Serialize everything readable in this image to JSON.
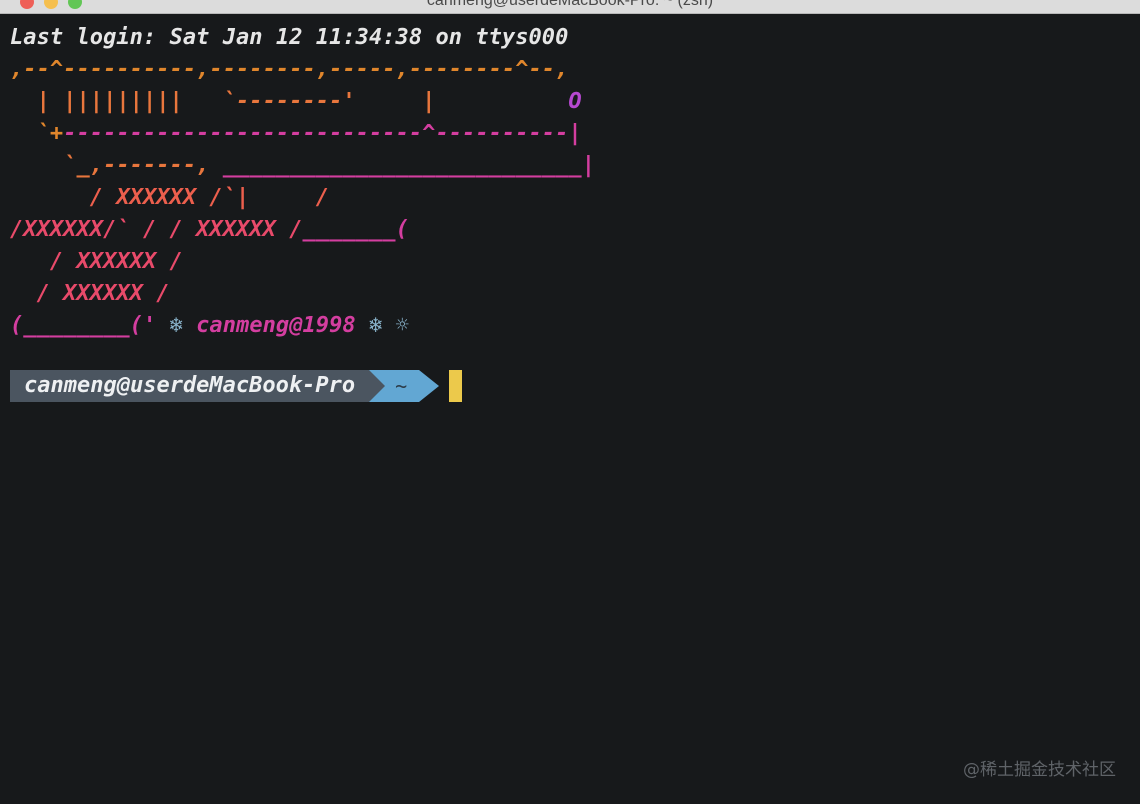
{
  "window": {
    "title": "canmeng@userdeMacBook-Pro: ~ (zsh)"
  },
  "terminal": {
    "login_line": "Last login: Sat Jan 12 11:34:38 on ttys000",
    "art": [
      {
        "segments": [
          {
            "text": ",--^----------,--------,-----,--------^--,",
            "color": "orange"
          }
        ]
      },
      {
        "segments": [
          {
            "text": "  | |||||||||   `--------'     |",
            "color": "orange2"
          },
          {
            "text": "          O",
            "color": "purple"
          }
        ]
      },
      {
        "segments": [
          {
            "text": "  `+",
            "color": "orange"
          },
          {
            "text": "---------------------------^----------|",
            "color": "magenta"
          }
        ]
      },
      {
        "segments": [
          {
            "text": "    `_,-------, ",
            "color": "orange2"
          },
          {
            "text": "___________________________|",
            "color": "magenta"
          }
        ]
      },
      {
        "segments": [
          {
            "text": "      / XXXXXX /`|     /",
            "color": "coral"
          }
        ]
      },
      {
        "segments": [
          {
            "text": "/XXXXXX/` / / XXXXXX /",
            "color": "pink"
          },
          {
            "text": "_______(",
            "color": "magenta"
          }
        ]
      },
      {
        "segments": [
          {
            "text": "   / XXXXXX /",
            "color": "pink"
          }
        ]
      },
      {
        "segments": [
          {
            "text": "  / XXXXXX /",
            "color": "pink"
          }
        ]
      },
      {
        "segments": [
          {
            "text": "(________(",
            "color": "magenta"
          },
          {
            "text": "' ",
            "color": "magenta"
          },
          {
            "text": "❄ ",
            "color": "cyan"
          },
          {
            "text": "canmeng@1998 ",
            "color": "magenta"
          },
          {
            "text": "❄ ☼",
            "color": "cyan"
          }
        ]
      }
    ]
  },
  "prompt": {
    "user_host": "canmeng@userdeMacBook-Pro",
    "directory": "~"
  },
  "watermark": "@稀土掘金技术社区",
  "colors": {
    "background": "#17191b",
    "orange": "#e0862c",
    "orange2": "#e8763d",
    "coral": "#ec5f4d",
    "pink": "#e84a6a",
    "magenta": "#d43ea0",
    "purple": "#b648d0",
    "cyan": "#8ab4cc",
    "prompt_user_bg": "#4b5560",
    "prompt_dir_bg": "#62a7d3",
    "cursor": "#ecc94b"
  },
  "icons": {
    "snowflake": "❄",
    "sun": "☼"
  }
}
